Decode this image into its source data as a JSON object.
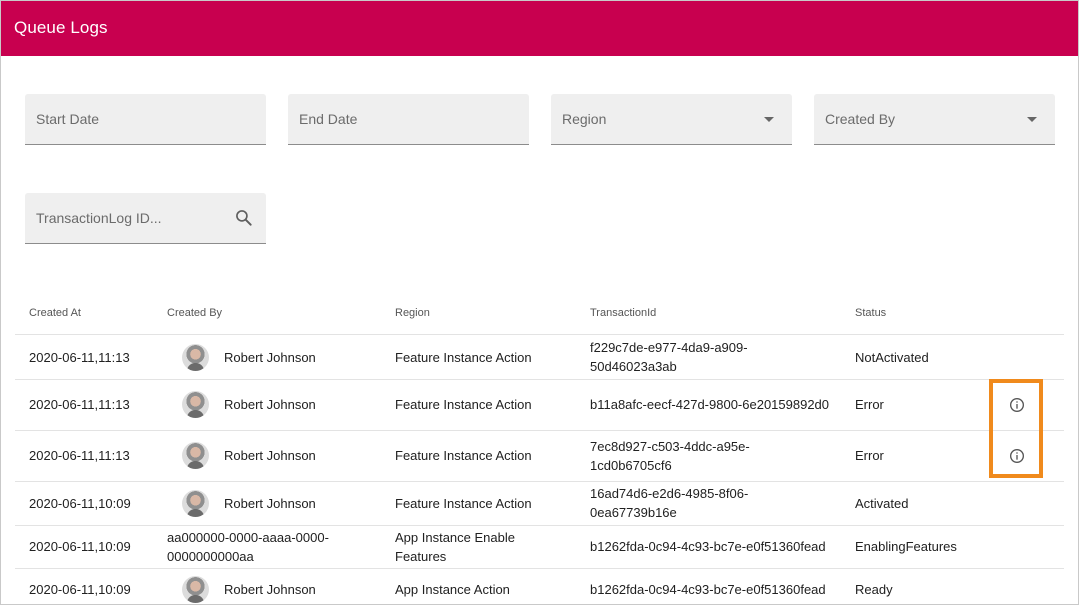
{
  "header": {
    "title": "Queue Logs"
  },
  "filters": {
    "start_date": "Start Date",
    "end_date": "End Date",
    "region": "Region",
    "created_by": "Created By",
    "transaction_search": "TransactionLog ID..."
  },
  "table": {
    "columns": [
      "Created At",
      "Created By",
      "Region",
      "TransactionId",
      "Status"
    ],
    "rows": [
      {
        "created_at": "2020-06-11,11:13",
        "created_by": "Robert Johnson",
        "has_avatar": true,
        "region": "Feature Instance Action",
        "transaction_id": [
          "f229c7de-e977-4da9-a909-",
          "50d46023a3ab"
        ],
        "status": "NotActivated",
        "has_info": false
      },
      {
        "created_at": "2020-06-11,11:13",
        "created_by": "Robert Johnson",
        "has_avatar": true,
        "region": "Feature Instance Action",
        "transaction_id": [
          "b11a8afc-eecf-427d-9800-6e20159892d0"
        ],
        "status": "Error",
        "has_info": true
      },
      {
        "created_at": "2020-06-11,11:13",
        "created_by": "Robert Johnson",
        "has_avatar": true,
        "region": "Feature Instance Action",
        "transaction_id": [
          "7ec8d927-c503-4ddc-a95e-",
          "1cd0b6705cf6"
        ],
        "status": "Error",
        "has_info": true
      },
      {
        "created_at": "2020-06-11,10:09",
        "created_by": "Robert Johnson",
        "has_avatar": true,
        "region": "Feature Instance Action",
        "transaction_id": [
          "16ad74d6-e2d6-4985-8f06-",
          "0ea67739b16e"
        ],
        "status": "Activated",
        "has_info": false
      },
      {
        "created_at": "2020-06-11,10:09",
        "created_by": [
          "aa000000-0000-aaaa-0000-",
          "0000000000aa"
        ],
        "has_avatar": false,
        "region": [
          "App Instance Enable",
          "Features"
        ],
        "transaction_id": [
          "b1262fda-0c94-4c93-bc7e-e0f51360fead"
        ],
        "status": "EnablingFeatures",
        "has_info": false
      },
      {
        "created_at": "2020-06-11,10:09",
        "created_by": "Robert Johnson",
        "has_avatar": true,
        "region": "App Instance Action",
        "transaction_id": [
          "b1262fda-0c94-4c93-bc7e-e0f51360fead"
        ],
        "status": "Ready",
        "has_info": false
      }
    ]
  },
  "icons": {
    "dropdown": "caret-down-icon",
    "search": "search-icon",
    "info": "info-icon"
  },
  "colors": {
    "header": "#c8004f",
    "highlight": "#f08a1c"
  }
}
